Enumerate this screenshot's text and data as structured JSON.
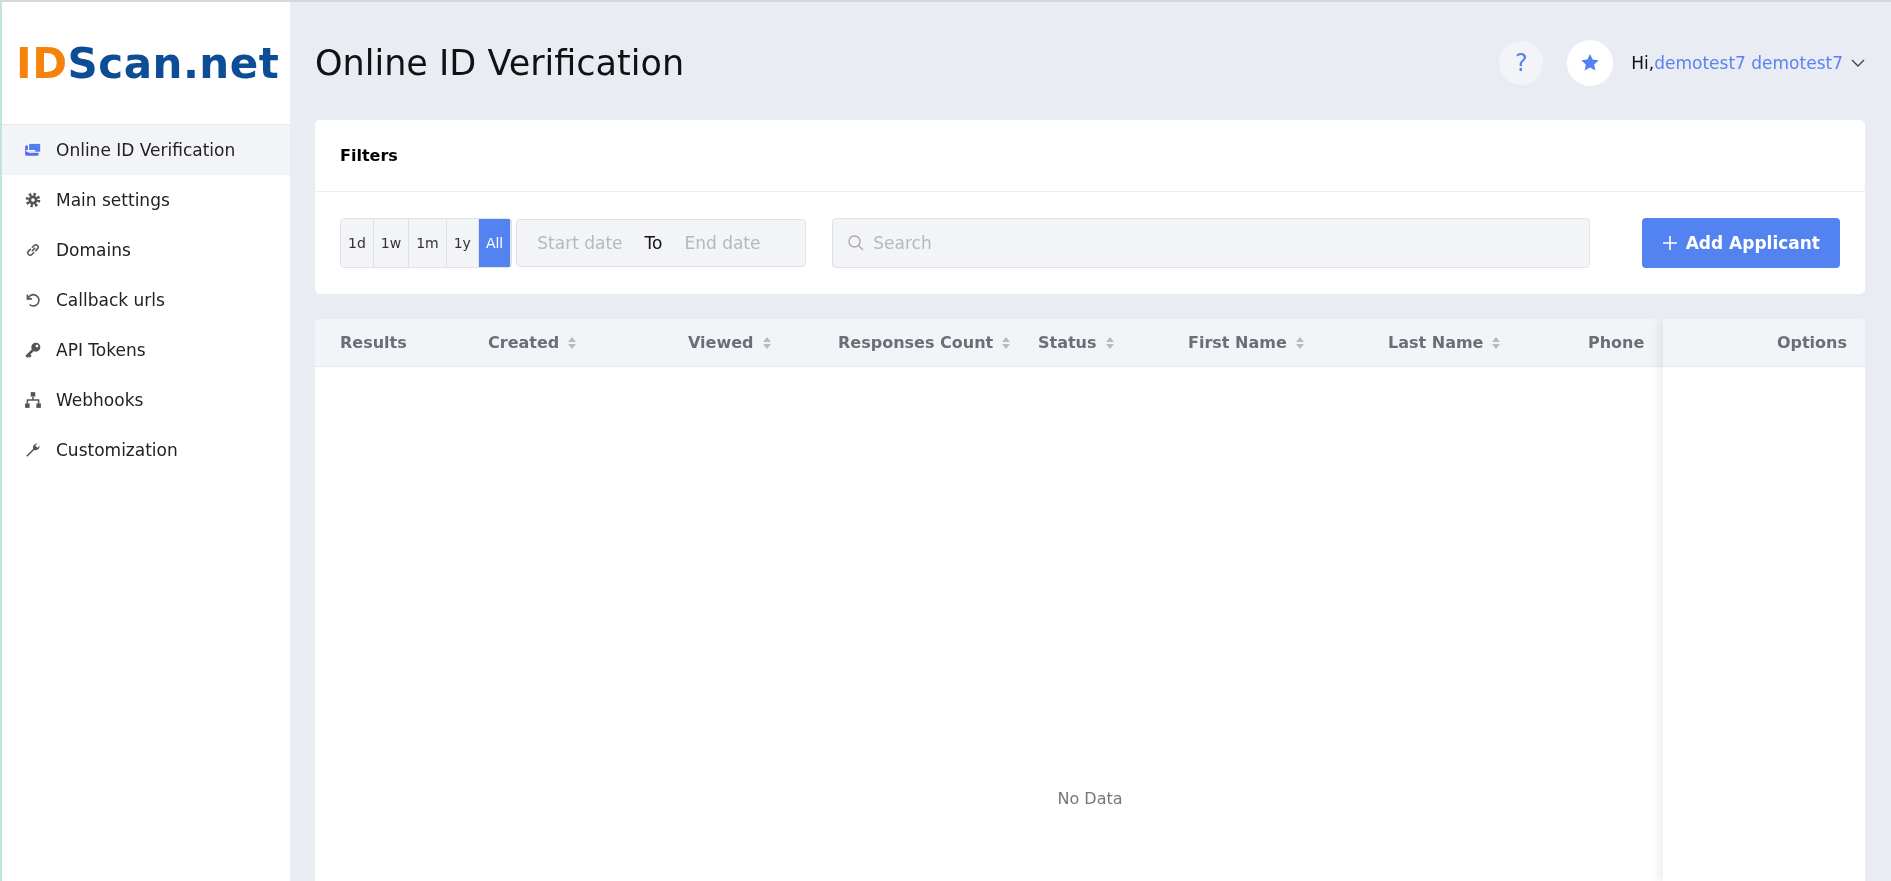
{
  "logo": {
    "accent": "ID",
    "rest": "Scan.net"
  },
  "sidebar": {
    "items": [
      {
        "label": "Online ID Verification",
        "selected": true
      },
      {
        "label": "Main settings",
        "selected": false
      },
      {
        "label": "Domains",
        "selected": false
      },
      {
        "label": "Callback urls",
        "selected": false
      },
      {
        "label": "API Tokens",
        "selected": false
      },
      {
        "label": "Webhooks",
        "selected": false
      },
      {
        "label": "Customization",
        "selected": false
      }
    ]
  },
  "header": {
    "title": "Online ID Verification",
    "help": "?",
    "greeting": "Hi,",
    "user": "demotest7 demotest7"
  },
  "filters": {
    "title": "Filters",
    "ranges": [
      {
        "label": "1d",
        "selected": false
      },
      {
        "label": "1w",
        "selected": false
      },
      {
        "label": "1m",
        "selected": false
      },
      {
        "label": "1y",
        "selected": false
      },
      {
        "label": "All",
        "selected": true
      }
    ],
    "start_placeholder": "Start date",
    "separator": "To",
    "end_placeholder": "End date",
    "search_placeholder": "Search",
    "add_button": "Add Applicant"
  },
  "table": {
    "columns": [
      {
        "label": "Results",
        "sortable": false
      },
      {
        "label": "Created",
        "sortable": true
      },
      {
        "label": "Viewed",
        "sortable": true
      },
      {
        "label": "Responses Count",
        "sortable": true
      },
      {
        "label": "Status",
        "sortable": true
      },
      {
        "label": "First Name",
        "sortable": true
      },
      {
        "label": "Last Name",
        "sortable": true
      },
      {
        "label": "Phone",
        "sortable": false
      }
    ],
    "options_column": "Options",
    "empty": "No Data"
  }
}
